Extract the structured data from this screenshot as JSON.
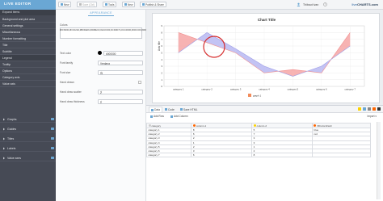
{
  "app": {
    "logo": "LIVE EDITOR",
    "brand_prefix": "live",
    "brand_suffix": "CHARTS.com",
    "brand_separator": ""
  },
  "toolbar": {
    "buttons": [
      {
        "label": "New",
        "icon": "new-icon"
      },
      {
        "label": "Save (Ctrl)",
        "icon": "save-icon"
      },
      {
        "label": "Tools",
        "icon": "tools-icon"
      },
      {
        "label": "New",
        "icon": "add-icon"
      },
      {
        "label": "Publish & Share",
        "icon": "share-icon"
      }
    ],
    "user": "Thibaut Ivan"
  },
  "sidebar": {
    "expand_label": "Expand items",
    "items": [
      {
        "label": "Background and plot area",
        "group": false
      },
      {
        "label": "General settings",
        "group": false
      },
      {
        "label": "Miscellaneous",
        "group": false
      },
      {
        "label": "Number formatting",
        "group": false
      },
      {
        "label": "Title",
        "group": false
      },
      {
        "label": "Subtitle",
        "group": false
      },
      {
        "label": "Legend",
        "group": false,
        "active": true
      },
      {
        "label": "Tooltip",
        "group": false
      },
      {
        "label": "Options",
        "group": false
      },
      {
        "label": "Category axis",
        "group": false
      },
      {
        "label": "Value axis",
        "group": false
      },
      {
        "label": "Graphs",
        "group": true
      },
      {
        "label": "Guides",
        "group": true
      },
      {
        "label": "Titles",
        "group": true
      },
      {
        "label": "Labels",
        "group": true
      },
      {
        "label": "Value axes",
        "group": true
      }
    ]
  },
  "settings": {
    "title": "APPEARANCE",
    "colors_label": "Colors",
    "colors_value": "#FF6600,#FCD202,#B0DE09,#0D8ECF,#2A0CD0,#CD0D74,#CC0000,#00CC00,#0000CC,#DDDDDD,#999999,#333333,#990000",
    "text_color_label": "Text color",
    "text_color_value": "#000000",
    "font_family_label": "Font family",
    "font_family_value": "Verdana",
    "font_size_label": "Font size",
    "font_size_value": "11",
    "hand_drawn_label": "Hand drawn",
    "hand_draw_scatter_label": "Hand draw scatter",
    "hand_draw_scatter_value": "2",
    "hand_draw_thickness_label": "Hand draw thickness",
    "hand_draw_thickness_value": "1"
  },
  "chart_data": {
    "type": "area",
    "title": "Chart Title",
    "ylabel": "Axis title",
    "categories": [
      "category 1",
      "category 2",
      "category 3",
      "category 4",
      "category 5",
      "category 6",
      "category 7"
    ],
    "series": [
      {
        "values": [
          8,
          6.5,
          5,
          2,
          2.5,
          2,
          8
        ],
        "color": "#f6a6a6"
      },
      {
        "values": [
          5,
          8,
          5.6,
          3,
          1.5,
          3,
          6
        ],
        "color": "#b9b9f2"
      }
    ],
    "yticks": [
      0,
      1,
      2,
      3,
      4,
      5,
      6,
      7,
      8,
      9
    ],
    "ylim": [
      0,
      9
    ],
    "legend": [
      {
        "name": "graph 1",
        "color": "#f28c5b"
      }
    ],
    "legend_placement": "bottom"
  },
  "grid": {
    "tabs": [
      "Data",
      "Code",
      "Save HTML"
    ],
    "add_row": "Add Row",
    "add_column": "Add Column",
    "import": "Import",
    "columns": [
      {
        "name": "category",
        "color": "#cccccc"
      },
      {
        "name": "column-1",
        "color": "#ff6600"
      },
      {
        "name": "column-2",
        "color": "#fcd202"
      },
      {
        "name": "fillColorsField",
        "color": "#ff6600"
      }
    ],
    "rows": [
      [
        "category 1",
        "8",
        "5",
        "blue"
      ],
      [
        "category 2",
        "6",
        "7",
        "red"
      ],
      [
        "category 3",
        "2",
        "3",
        ""
      ],
      [
        "category 4",
        "1",
        "3",
        ""
      ],
      [
        "category 5",
        "2",
        "1",
        ""
      ],
      [
        "category 6",
        "3",
        "2",
        ""
      ],
      [
        "category 7",
        "6",
        "8",
        ""
      ]
    ]
  }
}
